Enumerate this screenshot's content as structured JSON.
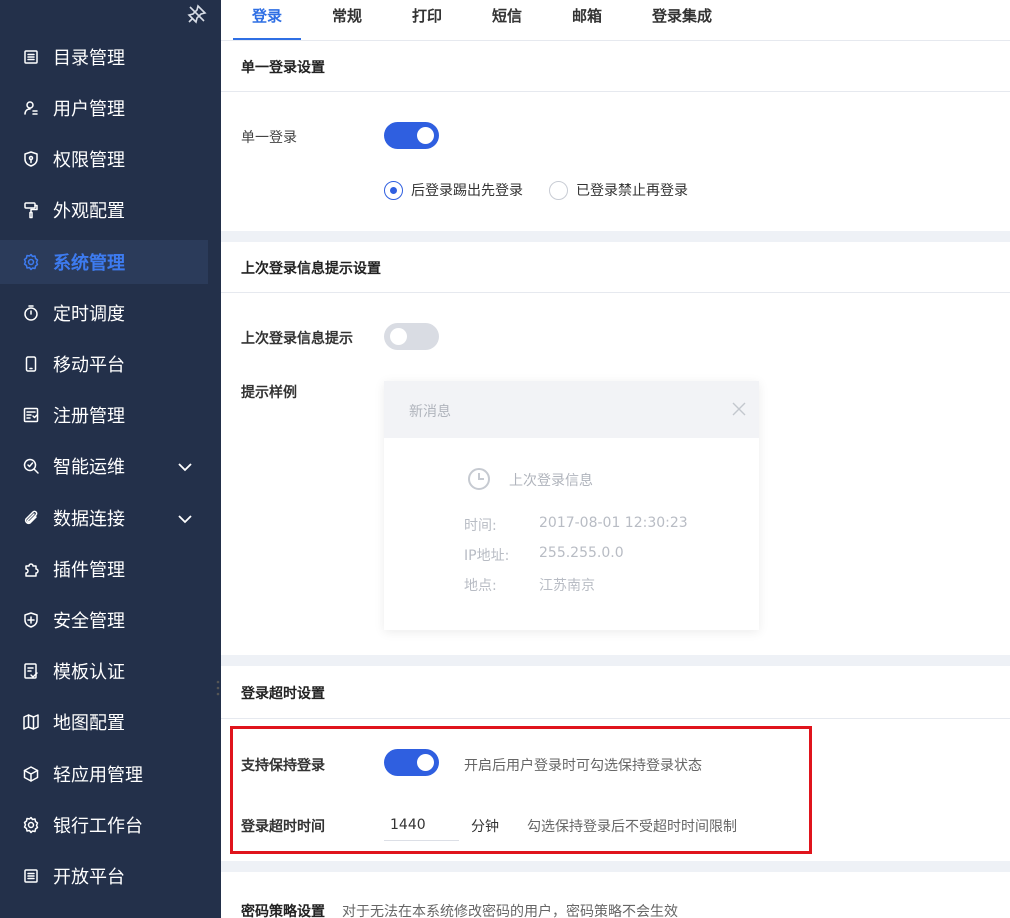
{
  "sidebar": {
    "items": [
      {
        "label": "目录管理",
        "icon": "list-icon"
      },
      {
        "label": "用户管理",
        "icon": "user-icon"
      },
      {
        "label": "权限管理",
        "icon": "shield-lock-icon"
      },
      {
        "label": "外观配置",
        "icon": "paint-roller-icon"
      },
      {
        "label": "系统管理",
        "icon": "gear-icon",
        "active": true
      },
      {
        "label": "定时调度",
        "icon": "stopwatch-icon"
      },
      {
        "label": "移动平台",
        "icon": "mobile-icon"
      },
      {
        "label": "注册管理",
        "icon": "register-icon"
      },
      {
        "label": "智能运维",
        "icon": "ops-search-icon",
        "expandable": true
      },
      {
        "label": "数据连接",
        "icon": "paperclip-icon",
        "expandable": true
      },
      {
        "label": "插件管理",
        "icon": "puzzle-icon"
      },
      {
        "label": "安全管理",
        "icon": "shield-plus-icon"
      },
      {
        "label": "模板认证",
        "icon": "template-check-icon"
      },
      {
        "label": "地图配置",
        "icon": "map-icon"
      },
      {
        "label": "轻应用管理",
        "icon": "cube-icon"
      },
      {
        "label": "银行工作台",
        "icon": "gear-icon"
      },
      {
        "label": "开放平台",
        "icon": "list-icon"
      }
    ]
  },
  "tabs": [
    "登录",
    "常规",
    "打印",
    "短信",
    "邮箱",
    "登录集成"
  ],
  "single_login": {
    "title": "单一登录设置",
    "label": "单一登录",
    "enabled": true,
    "options": [
      "后登录踢出先登录",
      "已登录禁止再登录"
    ],
    "selected": 0
  },
  "last_login": {
    "title": "上次登录信息提示设置",
    "label": "上次登录信息提示",
    "enabled": false,
    "sample_label": "提示样例",
    "sample": {
      "header": "新消息",
      "subtitle": "上次登录信息",
      "time_key": "时间:",
      "time_value": "2017-08-01 12:30:23",
      "ip_key": "IP地址:",
      "ip_value": "255.255.0.0",
      "place_key": "地点:",
      "place_value": "江苏南京"
    }
  },
  "timeout": {
    "title": "登录超时设置",
    "keep_label": "支持保持登录",
    "keep_enabled": true,
    "keep_hint": "开启后用户登录时可勾选保持登录状态",
    "time_label": "登录超时时间",
    "time_value": "1440",
    "unit": "分钟",
    "time_hint": "勾选保持登录后不受超时时间限制"
  },
  "password": {
    "title": "密码策略设置",
    "hint": "对于无法在本系统修改密码的用户，密码策略不会生效"
  },
  "colors": {
    "sidebar_bg": "#23304a",
    "accent": "#2f5fe0",
    "highlight": "#e0141c"
  }
}
